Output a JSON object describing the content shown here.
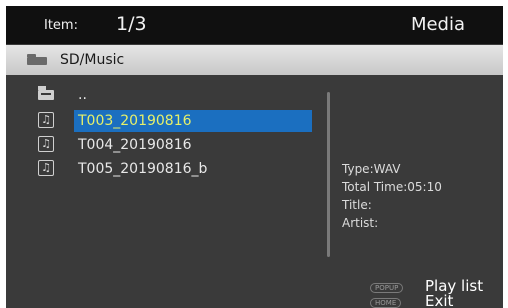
{
  "header": {
    "item_label": "Item:",
    "item_count": "1/3",
    "title": "Media"
  },
  "path": {
    "icon": "folder-icon",
    "text": "SD/Music"
  },
  "files": [
    {
      "label": "..",
      "icon": "parent-folder-icon",
      "selected": false
    },
    {
      "label": "T003_20190816",
      "icon": "music-file-icon",
      "selected": true
    },
    {
      "label": "T004_20190816",
      "icon": "music-file-icon",
      "selected": false
    },
    {
      "label": "T005_20190816_b",
      "icon": "music-file-icon",
      "selected": false
    }
  ],
  "info": {
    "type": "Type:WAV",
    "total_time": "Total Time:05:10",
    "title": "Title:",
    "artist": "Artist:"
  },
  "hints": [
    {
      "key": "POPUP",
      "label": "Play list"
    },
    {
      "key": "HOME",
      "label": "Exit"
    }
  ],
  "colors": {
    "selection_bg": "#1b6fc0",
    "selection_text": "#e6f06a",
    "background": "#3a3a3a"
  }
}
